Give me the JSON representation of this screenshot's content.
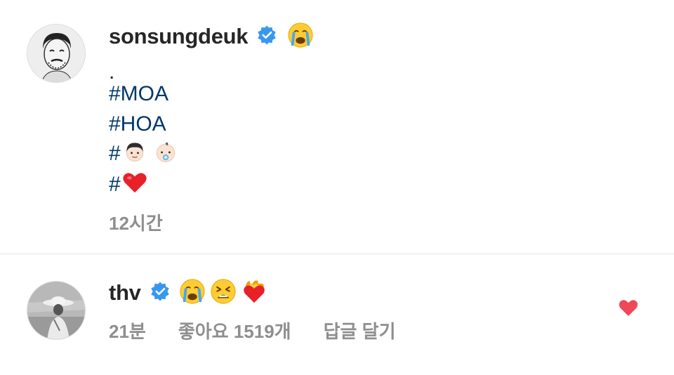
{
  "post": {
    "username": "sonsungdeuk",
    "caption_dot": ".",
    "hashtags": [
      "#MOA",
      "#HOA",
      "#",
      "#"
    ],
    "time": "12시간"
  },
  "comment": {
    "username": "thv",
    "time": "21분",
    "likes": "좋아요 1519개",
    "reply": "답글 달기"
  },
  "colors": {
    "hashtag": "#00376b",
    "verified": "#3897f0",
    "like_heart": "#ed4956",
    "meta": "#8e8e8e"
  },
  "icons": {
    "verified": "verified-badge-icon",
    "like": "heart-icon"
  }
}
